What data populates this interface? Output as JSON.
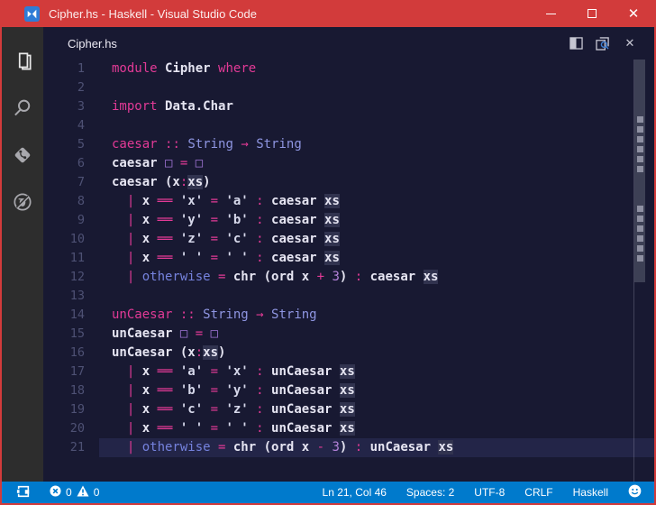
{
  "window": {
    "title": "Cipher.hs - Haskell - Visual Studio Code",
    "controls": {
      "minimize": "minimize",
      "maximize": "maximize",
      "close": "close"
    }
  },
  "colors": {
    "titlebar": "#d23b3b",
    "window_border": "#d23b3b",
    "statusbar": "#007acc",
    "editor_bg": "#181932",
    "activitybar_bg": "#2d2d2d",
    "keyword_pink": "#e23a96",
    "type_blue": "#8f96e2",
    "builtin_blue": "#7582dd",
    "number_purple": "#b583da",
    "word_highlight": "#31334f",
    "current_line": "#232548"
  },
  "activity_bar": {
    "items": [
      {
        "icon": "files-icon"
      },
      {
        "icon": "search-icon"
      },
      {
        "icon": "source-control-icon"
      },
      {
        "icon": "debug-disabled-icon"
      }
    ]
  },
  "tab_bar": {
    "label": "Cipher.hs",
    "actions": [
      {
        "icon": "split-editor-icon"
      },
      {
        "icon": "open-preview-icon"
      },
      {
        "icon": "close-editor-icon",
        "glyph": "✕"
      }
    ]
  },
  "editor": {
    "highlight_marks": [
      7,
      8,
      9,
      10,
      11,
      12,
      16,
      17,
      18,
      19,
      20,
      21
    ],
    "lines": [
      {
        "num": 1,
        "current": false,
        "tokens": [
          [
            "kw",
            "module "
          ],
          [
            "id",
            "Cipher "
          ],
          [
            "kw",
            "where"
          ]
        ]
      },
      {
        "num": 2,
        "current": false,
        "tokens": []
      },
      {
        "num": 3,
        "current": false,
        "tokens": [
          [
            "kw",
            "import "
          ],
          [
            "id",
            "Data.Char"
          ]
        ]
      },
      {
        "num": 4,
        "current": false,
        "tokens": []
      },
      {
        "num": 5,
        "current": false,
        "tokens": [
          [
            "fn",
            "caesar "
          ],
          [
            "op",
            ":: "
          ],
          [
            "ty",
            "String "
          ],
          [
            "op",
            "→ "
          ],
          [
            "ty",
            "String"
          ]
        ]
      },
      {
        "num": 6,
        "current": false,
        "tokens": [
          [
            "id",
            "caesar "
          ],
          [
            "box",
            "□"
          ],
          [
            "op",
            " = "
          ],
          [
            "box",
            "□"
          ]
        ]
      },
      {
        "num": 7,
        "current": false,
        "tokens": [
          [
            "id",
            "caesar (x"
          ],
          [
            "op",
            ":"
          ],
          [
            "hl",
            "xs"
          ],
          [
            "id",
            ")"
          ]
        ]
      },
      {
        "num": 8,
        "current": false,
        "tokens": [
          [
            "op",
            "  | "
          ],
          [
            "id",
            "x "
          ],
          [
            "op",
            "══"
          ],
          [
            "str",
            " 'x' "
          ],
          [
            "op",
            "= "
          ],
          [
            "str",
            "'a' "
          ],
          [
            "op",
            ": "
          ],
          [
            "id",
            "caesar "
          ],
          [
            "hl",
            "xs"
          ]
        ]
      },
      {
        "num": 9,
        "current": false,
        "tokens": [
          [
            "op",
            "  | "
          ],
          [
            "id",
            "x "
          ],
          [
            "op",
            "══"
          ],
          [
            "str",
            " 'y' "
          ],
          [
            "op",
            "= "
          ],
          [
            "str",
            "'b' "
          ],
          [
            "op",
            ": "
          ],
          [
            "id",
            "caesar "
          ],
          [
            "hl",
            "xs"
          ]
        ]
      },
      {
        "num": 10,
        "current": false,
        "tokens": [
          [
            "op",
            "  | "
          ],
          [
            "id",
            "x "
          ],
          [
            "op",
            "══"
          ],
          [
            "str",
            " 'z' "
          ],
          [
            "op",
            "= "
          ],
          [
            "str",
            "'c' "
          ],
          [
            "op",
            ": "
          ],
          [
            "id",
            "caesar "
          ],
          [
            "hl",
            "xs"
          ]
        ]
      },
      {
        "num": 11,
        "current": false,
        "tokens": [
          [
            "op",
            "  | "
          ],
          [
            "id",
            "x "
          ],
          [
            "op",
            "══"
          ],
          [
            "str",
            " ' ' "
          ],
          [
            "op",
            "= "
          ],
          [
            "str",
            "' ' "
          ],
          [
            "op",
            ": "
          ],
          [
            "id",
            "caesar "
          ],
          [
            "hl",
            "xs"
          ]
        ]
      },
      {
        "num": 12,
        "current": false,
        "tokens": [
          [
            "op",
            "  | "
          ],
          [
            "blue",
            "otherwise "
          ],
          [
            "op",
            "= "
          ],
          [
            "id",
            "chr (ord x "
          ],
          [
            "op",
            "+ "
          ],
          [
            "num",
            "3"
          ],
          [
            "id",
            ") "
          ],
          [
            "op",
            ": "
          ],
          [
            "id",
            "caesar "
          ],
          [
            "hl",
            "xs"
          ]
        ]
      },
      {
        "num": 13,
        "current": false,
        "tokens": []
      },
      {
        "num": 14,
        "current": false,
        "tokens": [
          [
            "fn",
            "unCaesar "
          ],
          [
            "op",
            ":: "
          ],
          [
            "ty",
            "String "
          ],
          [
            "op",
            "→ "
          ],
          [
            "ty",
            "String"
          ]
        ]
      },
      {
        "num": 15,
        "current": false,
        "tokens": [
          [
            "id",
            "unCaesar "
          ],
          [
            "box",
            "□"
          ],
          [
            "op",
            " = "
          ],
          [
            "box",
            "□"
          ]
        ]
      },
      {
        "num": 16,
        "current": false,
        "tokens": [
          [
            "id",
            "unCaesar (x"
          ],
          [
            "op",
            ":"
          ],
          [
            "hl",
            "xs"
          ],
          [
            "id",
            ")"
          ]
        ]
      },
      {
        "num": 17,
        "current": false,
        "tokens": [
          [
            "op",
            "  | "
          ],
          [
            "id",
            "x "
          ],
          [
            "op",
            "══"
          ],
          [
            "str",
            " 'a' "
          ],
          [
            "op",
            "= "
          ],
          [
            "str",
            "'x' "
          ],
          [
            "op",
            ": "
          ],
          [
            "id",
            "unCaesar "
          ],
          [
            "hl",
            "xs"
          ]
        ]
      },
      {
        "num": 18,
        "current": false,
        "tokens": [
          [
            "op",
            "  | "
          ],
          [
            "id",
            "x "
          ],
          [
            "op",
            "══"
          ],
          [
            "str",
            " 'b' "
          ],
          [
            "op",
            "= "
          ],
          [
            "str",
            "'y' "
          ],
          [
            "op",
            ": "
          ],
          [
            "id",
            "unCaesar "
          ],
          [
            "hl",
            "xs"
          ]
        ]
      },
      {
        "num": 19,
        "current": false,
        "tokens": [
          [
            "op",
            "  | "
          ],
          [
            "id",
            "x "
          ],
          [
            "op",
            "══"
          ],
          [
            "str",
            " 'c' "
          ],
          [
            "op",
            "= "
          ],
          [
            "str",
            "'z' "
          ],
          [
            "op",
            ": "
          ],
          [
            "id",
            "unCaesar "
          ],
          [
            "hl",
            "xs"
          ]
        ]
      },
      {
        "num": 20,
        "current": false,
        "tokens": [
          [
            "op",
            "  | "
          ],
          [
            "id",
            "x "
          ],
          [
            "op",
            "══"
          ],
          [
            "str",
            " ' ' "
          ],
          [
            "op",
            "= "
          ],
          [
            "str",
            "' ' "
          ],
          [
            "op",
            ": "
          ],
          [
            "id",
            "unCaesar "
          ],
          [
            "hl",
            "xs"
          ]
        ]
      },
      {
        "num": 21,
        "current": true,
        "tokens": [
          [
            "op",
            "  | "
          ],
          [
            "blue",
            "otherwise "
          ],
          [
            "op",
            "= "
          ],
          [
            "id",
            "chr (ord x "
          ],
          [
            "op",
            "- "
          ],
          [
            "num",
            "3"
          ],
          [
            "id",
            ") "
          ],
          [
            "op",
            ": "
          ],
          [
            "id",
            "unCaesar "
          ],
          [
            "hl",
            "xs"
          ]
        ]
      }
    ]
  },
  "status_bar": {
    "errors": "0",
    "warnings": "0",
    "cursor": "Ln 21, Col 46",
    "indent": "Spaces: 2",
    "encoding": "UTF-8",
    "eol": "CRLF",
    "language": "Haskell"
  }
}
